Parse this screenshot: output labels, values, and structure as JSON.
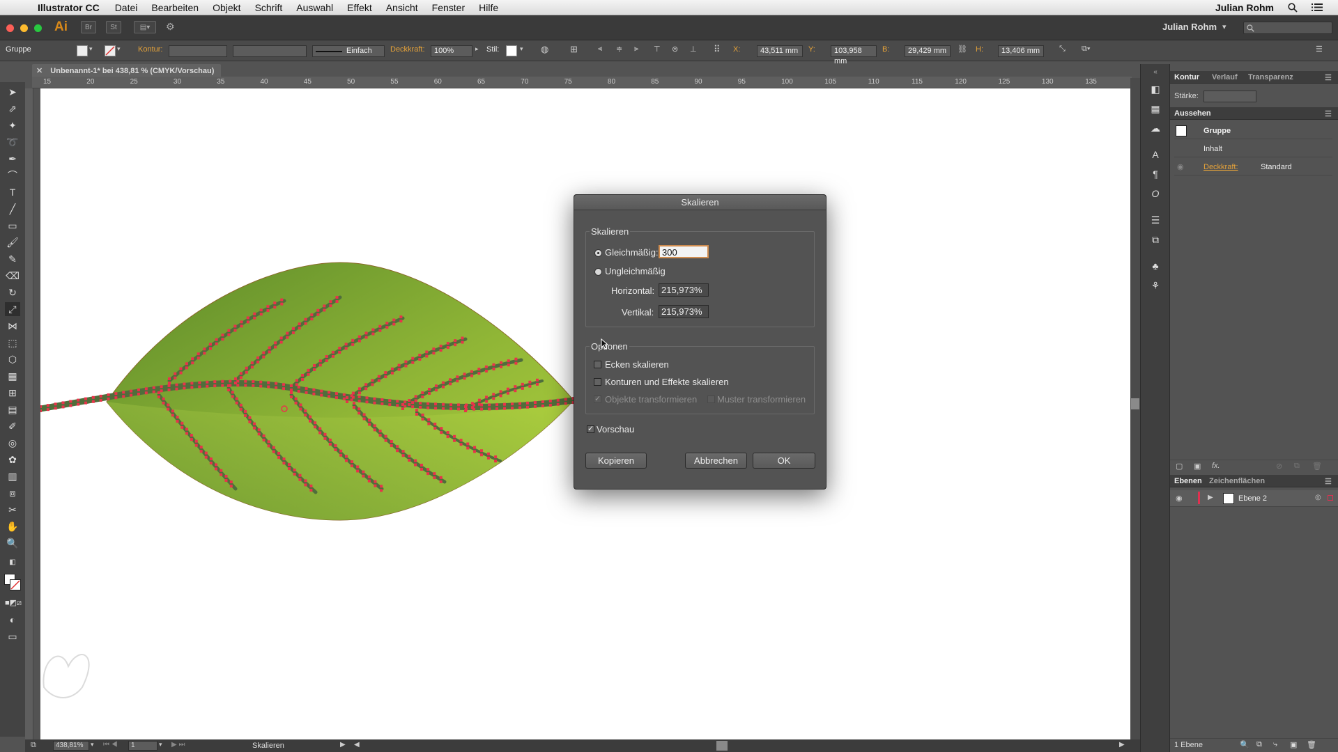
{
  "menubar": {
    "app_name": "Illustrator CC",
    "menus": [
      "Datei",
      "Bearbeiten",
      "Objekt",
      "Schrift",
      "Auswahl",
      "Effekt",
      "Ansicht",
      "Fenster",
      "Hilfe"
    ],
    "user": "Julian Rohm"
  },
  "appbar": {
    "logo": "Ai",
    "bridge": "Br",
    "stock": "St",
    "workspace_user": "Julian Rohm",
    "workspace_arrow": "▾"
  },
  "controlbar": {
    "selection": "Gruppe",
    "stroke_label": "Kontur:",
    "stroke_style": "Einfach",
    "opacity_label": "Deckkraft:",
    "opacity_value": "100%",
    "style_label": "Stil:",
    "x_label": "X:",
    "x_value": "43,511 mm",
    "y_label": "Y:",
    "y_value": "103,958 mm",
    "w_label": "B:",
    "w_value": "29,429 mm",
    "h_label": "H:",
    "h_value": "13,406 mm"
  },
  "document": {
    "tab_title": "Unbenannt-1* bei 438,81 % (CMYK/Vorschau)",
    "ruler_h": [
      "15",
      "20",
      "25",
      "30",
      "35",
      "40",
      "45",
      "50",
      "55",
      "60",
      "65",
      "70",
      "75",
      "80",
      "85",
      "90",
      "95",
      "100",
      "105",
      "110",
      "115",
      "120",
      "125",
      "130",
      "135"
    ]
  },
  "statusbar": {
    "zoom": "438,81%",
    "page": "1",
    "tool": "Skalieren"
  },
  "panels": {
    "top_tabs": [
      "Kontur",
      "Verlauf",
      "Transparenz"
    ],
    "stroke_weight_label": "Stärke:",
    "appearance_tab": "Aussehen",
    "appearance_group": "Gruppe",
    "appearance_contents": "Inhalt",
    "appearance_opacity_label": "Deckkraft:",
    "appearance_opacity_value": "Standard",
    "appearance_fx": "fx.",
    "layers_tabs": [
      "Ebenen",
      "Zeichenflächen"
    ],
    "layer_name": "Ebene 2",
    "layer_count": "1 Ebene"
  },
  "dialog": {
    "title": "Skalieren",
    "scale_group": "Skalieren",
    "uniform_label": "Gleichmäßig:",
    "uniform_value": "300",
    "nonuniform_label": "Ungleichmäßig",
    "horizontal_label": "Horizontal:",
    "horizontal_value": "215,973%",
    "vertical_label": "Vertikal:",
    "vertical_value": "215,973%",
    "options_group": "Optionen",
    "scale_corners": "Ecken skalieren",
    "scale_strokes": "Konturen und Effekte skalieren",
    "transform_objects": "Objekte transformieren",
    "transform_patterns": "Muster transformieren",
    "preview": "Vorschau",
    "copy_button": "Kopieren",
    "cancel_button": "Abbrechen",
    "ok_button": "OK"
  },
  "colors": {
    "leaf_light": "#a6c93a",
    "leaf_dark": "#5c8a2a",
    "vein": "#4f6e3b",
    "anchor": "#e8334a",
    "accent_orange": "#e6a33a"
  }
}
